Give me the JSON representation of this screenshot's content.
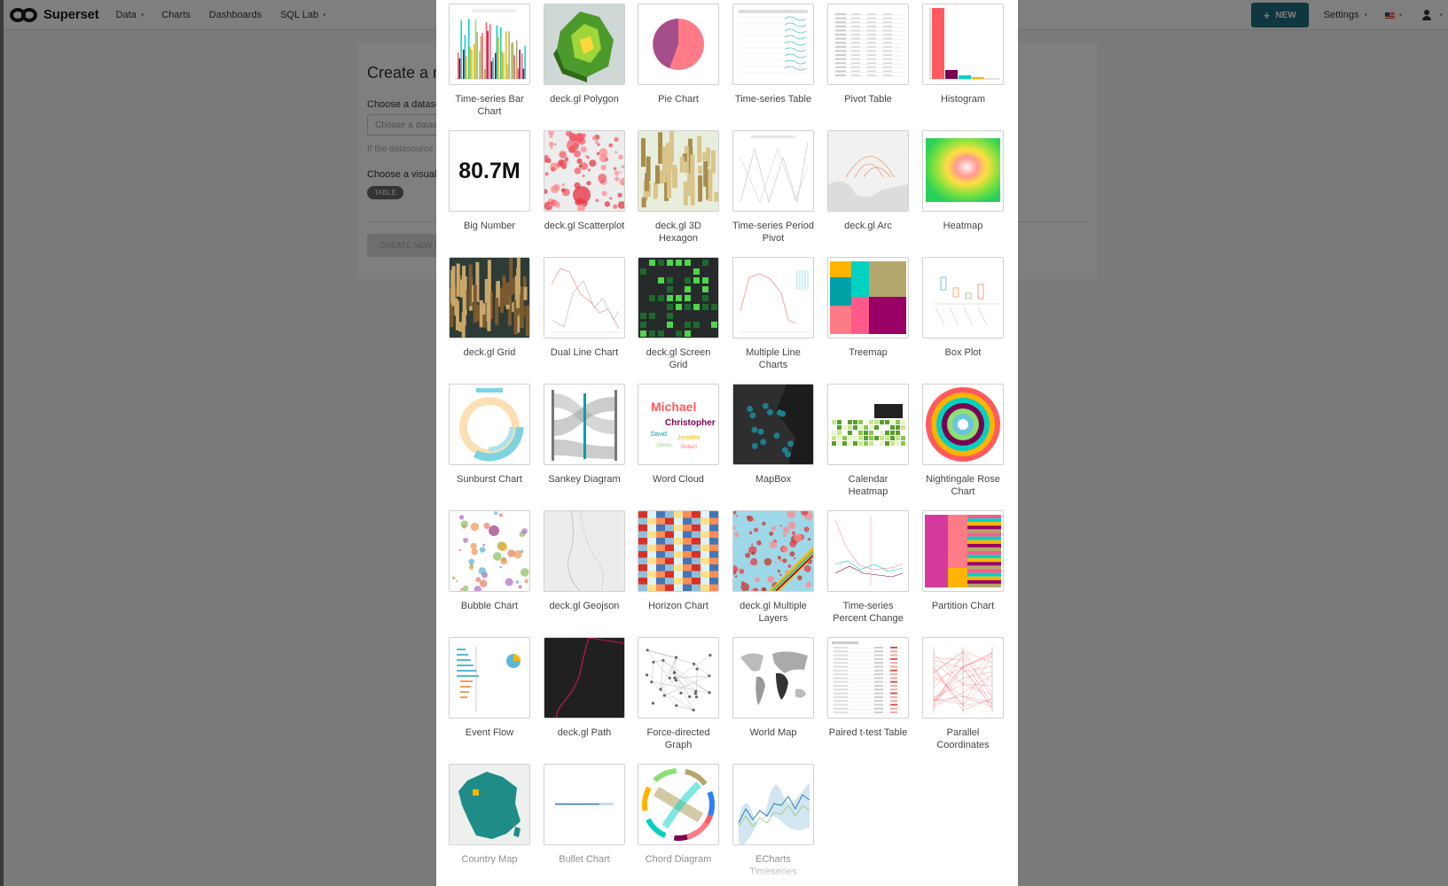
{
  "navbar": {
    "brand": "Superset",
    "items": [
      {
        "label": "Data",
        "caret": "▾"
      },
      {
        "label": "Charts",
        "caret": ""
      },
      {
        "label": "Dashboards",
        "caret": ""
      },
      {
        "label": "SQL Lab",
        "caret": "▾"
      }
    ],
    "new_button": "NEW",
    "new_plus": "+",
    "settings": "Settings",
    "caret": "▾"
  },
  "create_card": {
    "title": "Create a n",
    "choose_datasource": "Choose a datasou",
    "datasource_placeholder": "Choose a datas",
    "datasource_help": "If the datasource",
    "choose_visualization": "Choose a visuali",
    "viz_tag": "TABLE",
    "create_button": "CREATE NEW C"
  },
  "gallery": {
    "rows": [
      [
        {
          "label": "Time-series Bar Chart",
          "thumb": "bar"
        },
        {
          "label": "deck.gl Polygon",
          "thumb": "polygon"
        },
        {
          "label": "Pie Chart",
          "thumb": "pie"
        },
        {
          "label": "Time-series Table",
          "thumb": "tstable"
        },
        {
          "label": "Pivot Table",
          "thumb": "pivot"
        },
        {
          "label": "Histogram",
          "thumb": "histogram"
        }
      ],
      [
        {
          "label": "Big Number",
          "thumb": "bignumber",
          "value": "80.7M"
        },
        {
          "label": "deck.gl Scatterplot",
          "thumb": "scatterplot"
        },
        {
          "label": "deck.gl 3D Hexagon",
          "thumb": "hexagon"
        },
        {
          "label": "Time-series Period Pivot",
          "thumb": "periodpivot"
        },
        {
          "label": "deck.gl Arc",
          "thumb": "arc"
        },
        {
          "label": "Heatmap",
          "thumb": "heatmap"
        }
      ],
      [
        {
          "label": "deck.gl Grid",
          "thumb": "grid"
        },
        {
          "label": "Dual Line Chart",
          "thumb": "dualline"
        },
        {
          "label": "deck.gl Screen Grid",
          "thumb": "screengrid"
        },
        {
          "label": "Multiple Line Charts",
          "thumb": "multiline"
        },
        {
          "label": "Treemap",
          "thumb": "treemap"
        },
        {
          "label": "Box Plot",
          "thumb": "boxplot"
        }
      ],
      [
        {
          "label": "Sunburst Chart",
          "thumb": "sunburst"
        },
        {
          "label": "Sankey Diagram",
          "thumb": "sankey"
        },
        {
          "label": "Word Cloud",
          "thumb": "wordcloud"
        },
        {
          "label": "MapBox",
          "thumb": "mapbox"
        },
        {
          "label": "Calendar Heatmap",
          "thumb": "calendar"
        },
        {
          "label": "Nightingale Rose Chart",
          "thumb": "rose"
        }
      ],
      [
        {
          "label": "Bubble Chart",
          "thumb": "bubble"
        },
        {
          "label": "deck.gl Geojson",
          "thumb": "geojson"
        },
        {
          "label": "Horizon Chart",
          "thumb": "horizon"
        },
        {
          "label": "deck.gl Multiple Layers",
          "thumb": "multilayers"
        },
        {
          "label": "Time-series Percent Change",
          "thumb": "percentchange"
        },
        {
          "label": "Partition Chart",
          "thumb": "partition"
        }
      ],
      [
        {
          "label": "Event Flow",
          "thumb": "eventflow"
        },
        {
          "label": "deck.gl Path",
          "thumb": "path"
        },
        {
          "label": "Force-directed Graph",
          "thumb": "force"
        },
        {
          "label": "World Map",
          "thumb": "worldmap"
        },
        {
          "label": "Paired t-test Table",
          "thumb": "ttest"
        },
        {
          "label": "Parallel Coordinates",
          "thumb": "parallel"
        }
      ],
      [
        {
          "label": "Country Map",
          "thumb": "countrymap"
        },
        {
          "label": "Bullet Chart",
          "thumb": "bullet"
        },
        {
          "label": "Chord Diagram",
          "thumb": "chord"
        },
        {
          "label": "ECharts Timeseries",
          "thumb": "echarts"
        }
      ]
    ]
  }
}
